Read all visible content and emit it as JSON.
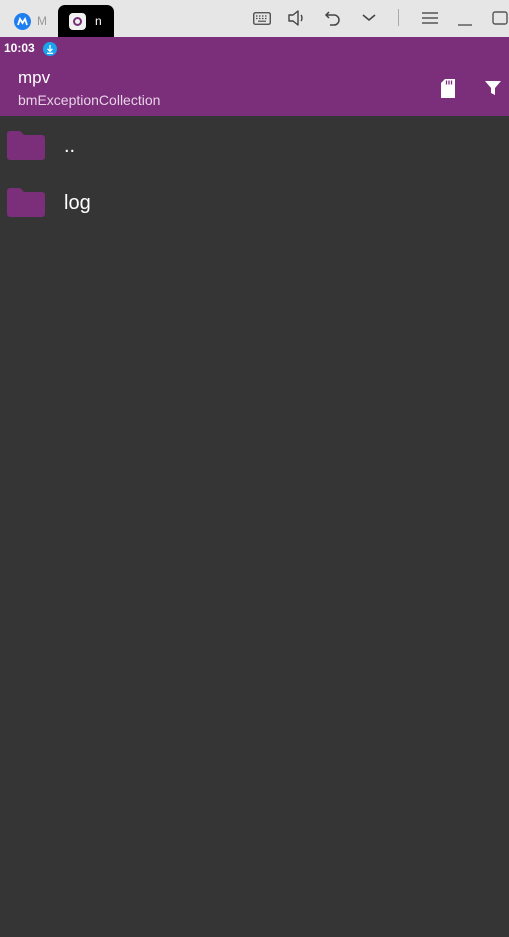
{
  "window": {
    "tabs": [
      {
        "label": "M",
        "icon": "app-icon"
      },
      {
        "label": "n",
        "icon": "mpv-icon"
      }
    ],
    "toolbar_icons": [
      "keyboard-icon",
      "volume-icon",
      "undo-icon",
      "chevron-down-icon",
      "menu-icon",
      "minimize-icon",
      "maximize-icon"
    ]
  },
  "status": {
    "time": "10:03",
    "notification_icon": "download-icon"
  },
  "appbar": {
    "title": "mpv",
    "subtitle": "bmExceptionCollection",
    "actions": [
      "sd-card-icon",
      "filter-icon"
    ]
  },
  "files": [
    {
      "name": "..",
      "type": "folder"
    },
    {
      "name": "log",
      "type": "folder"
    }
  ],
  "colors": {
    "accent": "#7b2f7a",
    "background": "#353535",
    "titlebar": "#e6e6e6"
  }
}
